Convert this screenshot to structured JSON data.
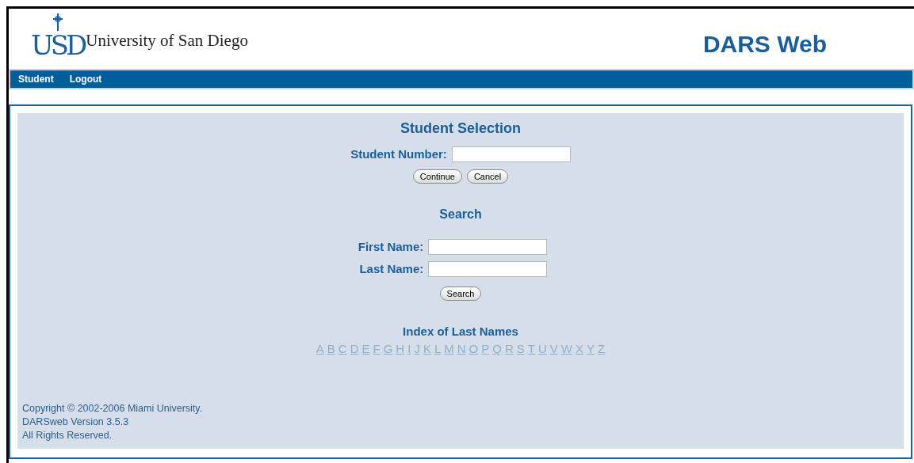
{
  "logo": {
    "monogram": "USD",
    "name": "University of San Diego"
  },
  "app_title": "DARS Web",
  "nav": [
    "Student",
    "Logout"
  ],
  "selection": {
    "title": "Student Selection",
    "field_label": "Student Number:",
    "buttons": [
      "Continue",
      "Cancel"
    ]
  },
  "search": {
    "title": "Search",
    "fields": [
      "First Name:",
      "Last Name:"
    ],
    "button": "Search"
  },
  "index": {
    "title": "Index of Last Names",
    "letters": [
      "A",
      "B",
      "C",
      "D",
      "E",
      "F",
      "G",
      "H",
      "I",
      "J",
      "K",
      "L",
      "M",
      "N",
      "O",
      "P",
      "Q",
      "R",
      "S",
      "T",
      "U",
      "V",
      "W",
      "X",
      "Y",
      "Z"
    ]
  },
  "footer": [
    "Copyright © 2002-2006 Miami University.",
    "DARSweb Version 3.5.3",
    "All Rights Reserved."
  ]
}
